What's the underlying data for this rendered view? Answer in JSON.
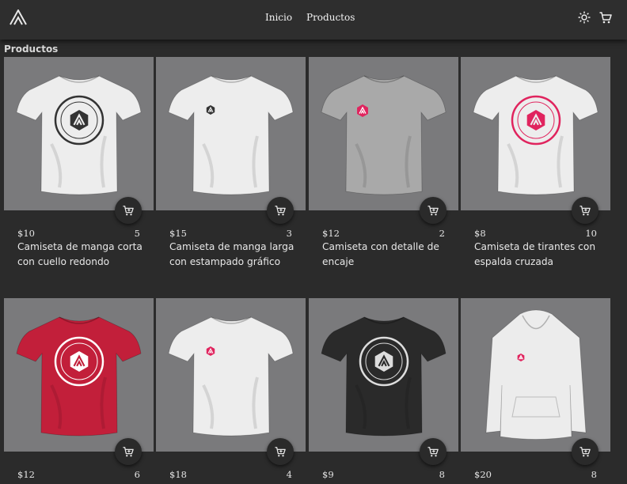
{
  "header": {
    "logo_icon": "academlo-logo-icon",
    "nav": [
      {
        "label": "Inicio"
      },
      {
        "label": "Productos"
      }
    ],
    "theme_icon": "sun-icon",
    "cart_icon": "cart-icon"
  },
  "section": {
    "title": "Productos"
  },
  "colors": {
    "accent": "#e0245e",
    "background": "#2b2b2b",
    "card_image_bg": "#7a7a7c"
  },
  "products": [
    {
      "price": "$10",
      "stock": "5",
      "name": "Camiseta de manga corta con cuello redondo",
      "garment": "tshirt",
      "color": "#ededed",
      "print": "Academlo Desarrollo Web Full Stack",
      "print_color": "#333333"
    },
    {
      "price": "$15",
      "stock": "3",
      "name": "Camiseta de manga larga con estampado gráfico",
      "garment": "tshirt",
      "color": "#ededed",
      "print": "",
      "print_color": "#333333"
    },
    {
      "price": "$12",
      "stock": "2",
      "name": "Camiseta con detalle de encaje",
      "garment": "tshirt",
      "color": "#a9a9a9",
      "print": "Academlo",
      "print_color": "#e0245e"
    },
    {
      "price": "$8",
      "stock": "10",
      "name": "Camiseta de tirantes con espalda cruzada",
      "garment": "tshirt",
      "color": "#ededed",
      "print": "Desarrollo Web Full Stack Academlo",
      "print_color": "#e0245e"
    },
    {
      "price": "$12",
      "stock": "6",
      "name": "",
      "garment": "tshirt",
      "color": "#c21f3a",
      "print": "ACADEMLO Desarrollo Web Full Stack",
      "print_color": "#ffffff"
    },
    {
      "price": "$18",
      "stock": "4",
      "name": "",
      "garment": "tshirt",
      "color": "#ededed",
      "print": "",
      "print_color": "#e0245e"
    },
    {
      "price": "$9",
      "stock": "8",
      "name": "",
      "garment": "tshirt",
      "color": "#2a2a2a",
      "print": "Academlo Desarrollo Web Full Stack",
      "print_color": "#dddddd"
    },
    {
      "price": "$20",
      "stock": "8",
      "name": "",
      "garment": "hoodie",
      "color": "#ececec",
      "print": "",
      "print_color": "#e0245e"
    }
  ]
}
